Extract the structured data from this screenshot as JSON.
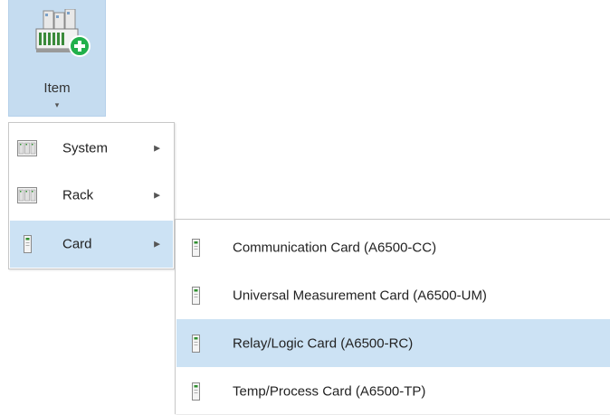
{
  "ribbon": {
    "item_button": {
      "label": "Item",
      "dropdown_glyph": "▾",
      "icon": "add-item-icon",
      "background": "#c5dcf0"
    }
  },
  "menu": {
    "items": [
      {
        "label": "System",
        "icon": "system-rack-icon",
        "has_submenu": true,
        "highlighted": false
      },
      {
        "label": "Rack",
        "icon": "system-rack-icon",
        "has_submenu": true,
        "highlighted": false
      },
      {
        "label": "Card",
        "icon": "card-icon",
        "has_submenu": true,
        "highlighted": true
      }
    ],
    "submenu_glyph": "▶"
  },
  "submenu": {
    "items": [
      {
        "label": "Communication Card (A6500-CC)",
        "icon": "card-icon",
        "highlighted": false
      },
      {
        "label": "Universal Measurement Card (A6500-UM)",
        "icon": "card-icon",
        "highlighted": false
      },
      {
        "label": "Relay/Logic Card (A6500-RC)",
        "icon": "card-icon",
        "highlighted": true
      },
      {
        "label": "Temp/Process Card (A6500-TP)",
        "icon": "card-icon",
        "highlighted": false
      }
    ]
  },
  "colors": {
    "highlight": "#cce2f4",
    "ribbon_active": "#c5dcf0",
    "menu_border": "#c8c8c8",
    "add_badge": "#21b04b"
  }
}
